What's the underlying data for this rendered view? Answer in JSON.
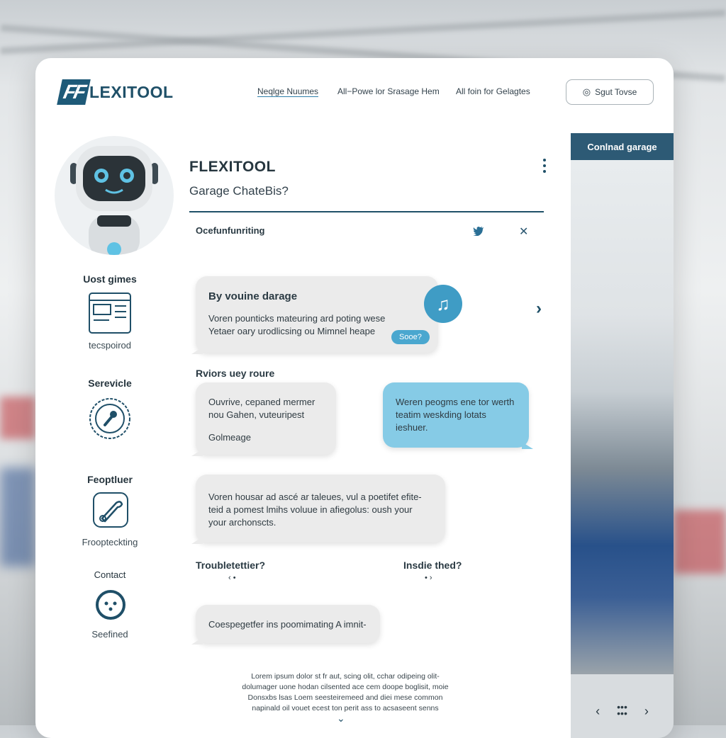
{
  "brand": {
    "mark": "FF",
    "name": "LEXITOOL"
  },
  "nav": {
    "item1": "Neqlge Nuumes",
    "item2": "All−Powe lor Srasage Hem",
    "item3": "All foin for Gelagtes"
  },
  "top_button": {
    "label": "Sgut Tovse"
  },
  "header": {
    "title": "FLEXITOOL",
    "subtitle": "Garage ChateBis?",
    "section": "Ocefunfunriting"
  },
  "sidebar": {
    "item1_title": "Uost gimes",
    "item1_sub": "tecspoirod",
    "item2_title": "Serevicle",
    "item3_title": "Feoptluer",
    "item3_sub": "Froopteckting",
    "item4_title": "Contact",
    "item4_sub": "Seefined"
  },
  "chat": {
    "b1_title": "By vouine darage",
    "b1_line1": "Voren pounticks mateuring ard poting wese",
    "b1_line2": "Yetaer oary urodlicsing ou Mimnel heape",
    "b1_chip": "Sooe?",
    "section2": "Rviors uey roure",
    "b2_line1": "Ouvrive, cepaned mermer",
    "b2_line2": "nou Gahen, vuteuripest",
    "b2_line3": "Golmeage",
    "b3_line1": "Weren peogms ene tor werth",
    "b3_line2": "teatim weskding lotats",
    "b3_line3": "ieshuer.",
    "b4_line1": "Voren housar ad ascé ar taleues, vul a poetifet efite-",
    "b4_line2": "teid a pomest lmihs voluue in afiegolus: oush your",
    "b4_line3": "your archonscts.",
    "section3a": "Troubletettier?",
    "section3b": "Insdie thed?",
    "b5": "Coespegetfer ins poomimating A imnit-"
  },
  "footer": {
    "line1": "Lorem ipsum dolor st fr aut, scing olit, cchar odipeing olit-",
    "line2": "dolumager uone hodan cilsented ace cem doope boglisit, moie",
    "line3": "Donsxbs lsas Loem seesteiremeed and diei mese common",
    "line4": "napinald oil vouet ecest ton perit ass to acsaseent senns"
  },
  "right_panel": {
    "header": "Conlnad garage"
  },
  "colors": {
    "primary": "#1f5068",
    "accent": "#3f9cc5",
    "bubble": "#ebebeb",
    "bubble_blue": "#86cbe6"
  }
}
